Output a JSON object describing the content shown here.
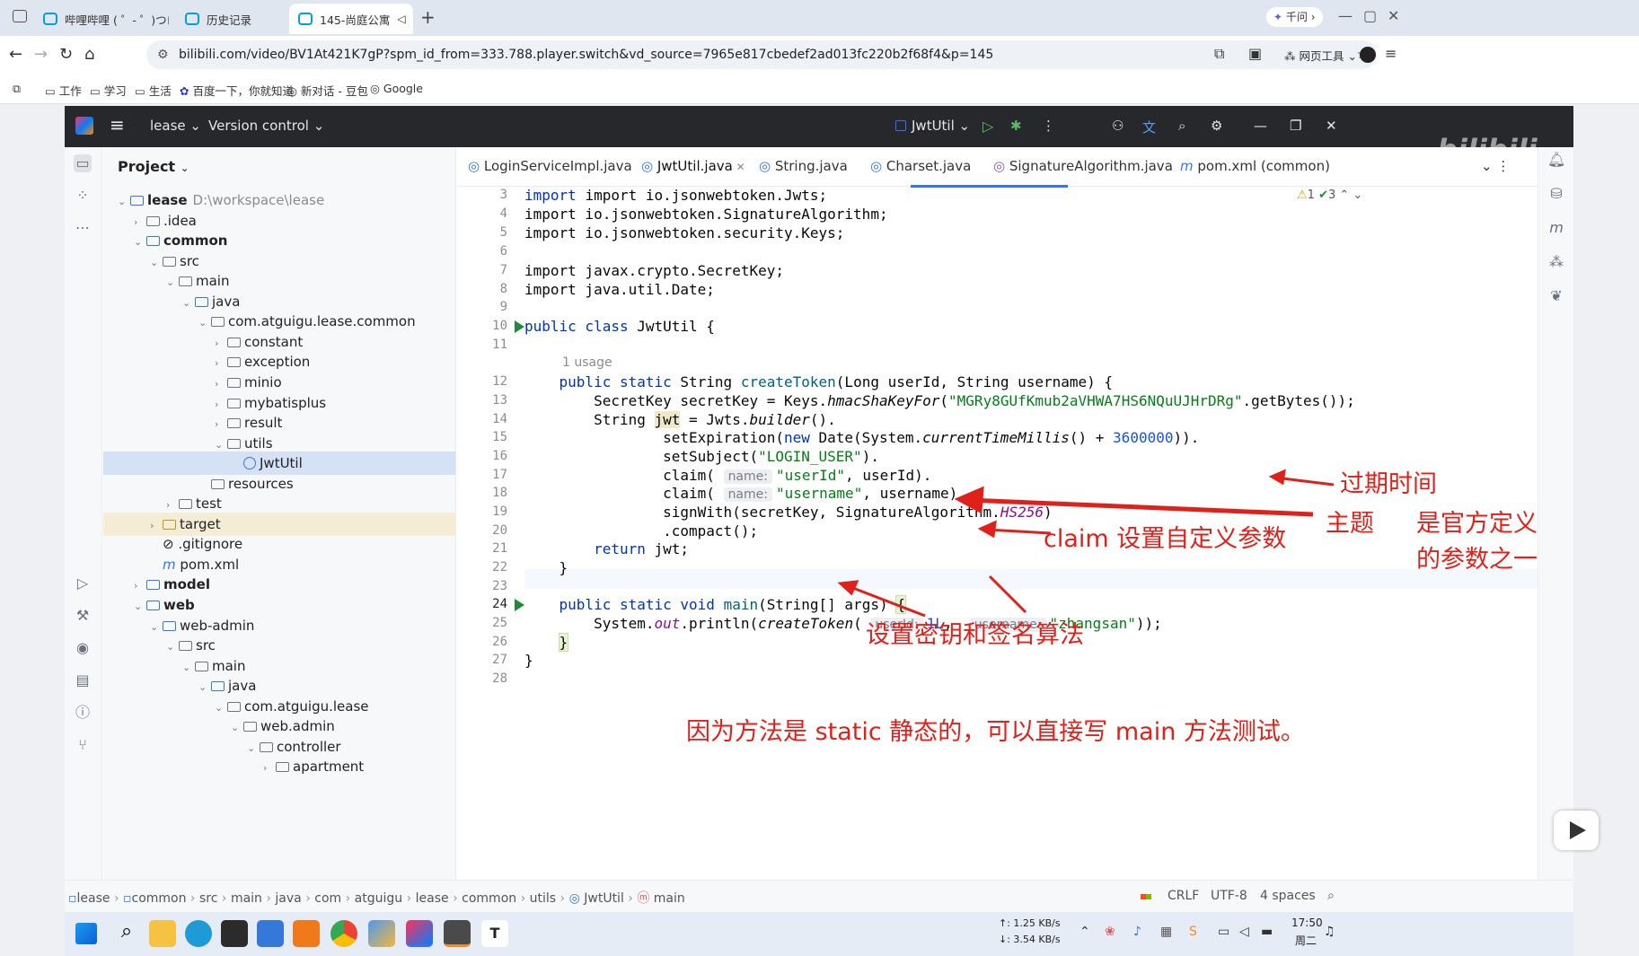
{
  "browser": {
    "tabs": [
      {
        "label": "哔哩哔哩 ( ゜- ゜)つロ"
      },
      {
        "label": "历史记录"
      },
      {
        "label": "145-尚庭公寓"
      }
    ],
    "url": "bilibili.com/video/BV1At421K7gP?spm_id_from=333.788.player.switch&vd_source=7965e817cbedef2ad013fc220b2f68f4&p=145",
    "right_label": "千问",
    "webtools_label": "网页工具",
    "bookmarks": [
      "工作",
      "学习",
      "生活",
      "百度一下，你就知道",
      "新对话 - 豆包",
      "Google"
    ]
  },
  "ide": {
    "project_name": "lease",
    "vcs": "Version control",
    "run_config": "JwtUtil",
    "project_label": "Project",
    "tree": [
      {
        "label": "lease",
        "extra": "D:\\workspace\\lease"
      },
      {
        "label": ".idea"
      },
      {
        "label": "common"
      },
      {
        "label": "src"
      },
      {
        "label": "main"
      },
      {
        "label": "java"
      },
      {
        "label": "com.atguigu.lease.common"
      },
      {
        "label": "constant"
      },
      {
        "label": "exception"
      },
      {
        "label": "minio"
      },
      {
        "label": "mybatisplus"
      },
      {
        "label": "result"
      },
      {
        "label": "utils"
      },
      {
        "label": "JwtUtil"
      },
      {
        "label": "resources"
      },
      {
        "label": "test"
      },
      {
        "label": "target"
      },
      {
        "label": ".gitignore"
      },
      {
        "label": "pom.xml"
      },
      {
        "label": "model"
      },
      {
        "label": "web"
      },
      {
        "label": "web-admin"
      },
      {
        "label": "src"
      },
      {
        "label": "main"
      },
      {
        "label": "java"
      },
      {
        "label": "com.atguigu.lease"
      },
      {
        "label": "web.admin"
      },
      {
        "label": "controller"
      },
      {
        "label": "apartment"
      }
    ],
    "editor_tabs": [
      "LoginServiceImpl.java",
      "JwtUtil.java",
      "String.java",
      "Charset.java",
      "SignatureAlgorithm.java",
      "pom.xml (common)"
    ],
    "inspections": {
      "warnings": "1",
      "ok": "3"
    },
    "line_numbers": [
      "3",
      "4",
      "5",
      "6",
      "7",
      "8",
      "9",
      "10",
      "11",
      "12",
      "13",
      "14",
      "15",
      "16",
      "17",
      "18",
      "19",
      "20",
      "21",
      "22",
      "23",
      "24",
      "25",
      "26",
      "27",
      "28"
    ],
    "usage_hint": "1 usage",
    "hints": {
      "name": "name:",
      "userId": "userId:",
      "username": "username:"
    },
    "code": {
      "l3": "import io.jsonwebtoken.Jwts;",
      "l4": "import io.jsonwebtoken.SignatureAlgorithm;",
      "l5": "import io.jsonwebtoken.security.Keys;",
      "l7": "import javax.crypto.SecretKey;",
      "l8": "import java.util.Date;",
      "secret": "\"MGRy8GUfKmub2aVHWA7HS6NQuUJHrDRg\"",
      "subject": "\"LOGIN_USER\"",
      "claim1": "\"userId\"",
      "claim2": "\"username\"",
      "expiry": "3600000",
      "alg": "HS256",
      "arg1": "1L",
      "arg2": "\"zhangsan\""
    },
    "breadcrumb": [
      "lease",
      "common",
      "src",
      "main",
      "java",
      "com",
      "atguigu",
      "lease",
      "common",
      "utils",
      "JwtUtil",
      "main"
    ],
    "status": {
      "line_sep": "CRLF",
      "encoding": "UTF-8",
      "indent": "4 spaces"
    }
  },
  "annotations": {
    "expiry": "过期时间",
    "subject": "主题",
    "claim": "claim 设置自定义参数",
    "official1": "是官方定义",
    "official2": "的参数之一",
    "sign": "设置密钥和签名算法",
    "static_note": "因为方法是 static 静态的，可以直接写 main 方法测试。"
  },
  "taskbar": {
    "up": "↑: 1.25 KB/s",
    "down": "↓: 3.54 KB/s",
    "time": "17:50",
    "day": "周二"
  },
  "colors": {
    "accent": "#3574f0",
    "annotation": "#e0201a",
    "ide_dark": "#27282c"
  }
}
